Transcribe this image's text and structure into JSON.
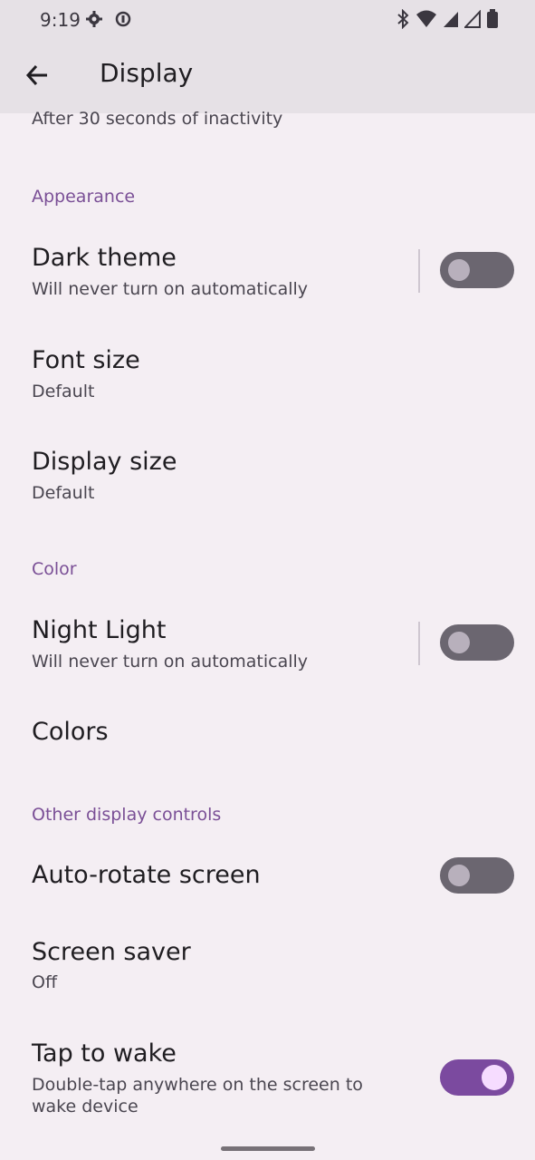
{
  "status": {
    "time": "9:19",
    "icons_left": [
      "gear-icon",
      "data-saver-icon"
    ],
    "icons_right": [
      "bluetooth-icon",
      "wifi-icon",
      "signal-icon",
      "signal-icon",
      "battery-icon"
    ]
  },
  "header": {
    "title": "Display"
  },
  "screen_timeout": {
    "summary": "After 30 seconds of inactivity"
  },
  "sections": {
    "appearance": "Appearance",
    "color": "Color",
    "other": "Other display controls"
  },
  "items": {
    "dark_theme": {
      "title": "Dark theme",
      "summary": "Will never turn on automatically",
      "enabled": false
    },
    "font_size": {
      "title": "Font size",
      "summary": "Default"
    },
    "display_size": {
      "title": "Display size",
      "summary": "Default"
    },
    "night_light": {
      "title": "Night Light",
      "summary": "Will never turn on automatically",
      "enabled": false
    },
    "colors": {
      "title": "Colors"
    },
    "auto_rotate": {
      "title": "Auto-rotate screen",
      "enabled": false
    },
    "screen_saver": {
      "title": "Screen saver",
      "summary": "Off"
    },
    "tap_to_wake": {
      "title": "Tap to wake",
      "summary": "Double-tap anywhere on the screen to wake device",
      "enabled": true
    }
  },
  "colors": {
    "accent": "#7b4a9f",
    "section_header": "#7a4f96",
    "switch_off": "#6b6670",
    "background": "#f4eef3"
  }
}
